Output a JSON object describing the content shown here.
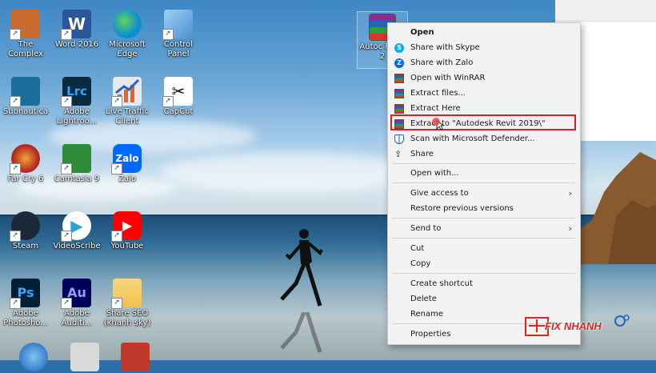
{
  "desktop_icons": [
    {
      "label": "The Complex",
      "icon": "the-complex-icon",
      "color": "#c96a2f"
    },
    {
      "label": "Word 2016",
      "icon": "word-icon",
      "color": "#2b579a"
    },
    {
      "label": "Microsoft Edge",
      "icon": "edge-icon",
      "color": "#0c8dd6"
    },
    {
      "label": "Control Panel",
      "icon": "control-panel-icon",
      "color": "#4a90d0"
    },
    {
      "label": "Subnautica",
      "icon": "subnautica-icon",
      "color": "#1b6f9a"
    },
    {
      "label": "Adobe Lightroo...",
      "icon": "lightroom-icon",
      "color": "#0b2a3f"
    },
    {
      "label": "Live Traffic Client",
      "icon": "live-traffic-icon",
      "color": "#e8e8e8"
    },
    {
      "label": "CapCut",
      "icon": "capcut-icon",
      "color": "#ffffff"
    },
    {
      "label": "Far Cry 6",
      "icon": "far-cry-icon",
      "color": "#b3261e"
    },
    {
      "label": "Camtasia 9",
      "icon": "camtasia-icon",
      "color": "#2e8b3a"
    },
    {
      "label": "Zalo",
      "icon": "zalo-icon",
      "color": "#0068ff"
    },
    {
      "label": "Steam",
      "icon": "steam-icon",
      "color": "#1b2838"
    },
    {
      "label": "VideoScribe",
      "icon": "videoscribe-icon",
      "color": "#2da0d8"
    },
    {
      "label": "YouTube",
      "icon": "youtube-icon",
      "color": "#ff0000"
    },
    {
      "label": "Adobe Photosho...",
      "icon": "photoshop-icon",
      "color": "#001e36"
    },
    {
      "label": "Adobe Auditi...",
      "icon": "audition-icon",
      "color": "#00005b"
    },
    {
      "label": "Share SEO (khanh sky)",
      "icon": "folder-icon",
      "color": "#f2c14e"
    }
  ],
  "selected_file": {
    "label": "Autoc Revit 2",
    "icon": "winrar-archive-icon"
  },
  "context_menu": {
    "items": [
      {
        "label": "Open",
        "bold": true,
        "icon": ""
      },
      {
        "label": "Share with Skype",
        "icon": "skype-icon"
      },
      {
        "label": "Share with Zalo",
        "icon": "zalo-small-icon"
      },
      {
        "label": "Open with WinRAR",
        "icon": "winrar-icon"
      },
      {
        "label": "Extract files...",
        "icon": "winrar-icon"
      },
      {
        "label": "Extract Here",
        "icon": "winrar-icon"
      },
      {
        "label": "Extract to \"Autodesk Revit 2019\\\"",
        "icon": "winrar-icon"
      },
      {
        "label": "Scan with Microsoft Defender...",
        "icon": "defender-icon"
      },
      {
        "label": "Share",
        "icon": "share-icon"
      },
      {
        "label": "Open with...",
        "icon": ""
      },
      {
        "label": "Give access to",
        "icon": "",
        "submenu": true
      },
      {
        "label": "Restore previous versions",
        "icon": ""
      },
      {
        "label": "Send to",
        "icon": "",
        "submenu": true
      },
      {
        "label": "Cut",
        "icon": ""
      },
      {
        "label": "Copy",
        "icon": ""
      },
      {
        "label": "Create shortcut",
        "icon": ""
      },
      {
        "label": "Delete",
        "icon": ""
      },
      {
        "label": "Rename",
        "icon": ""
      },
      {
        "label": "Properties",
        "icon": ""
      }
    ]
  },
  "watermark": {
    "text": "FIX NHANH",
    "color": "#e0231f"
  }
}
